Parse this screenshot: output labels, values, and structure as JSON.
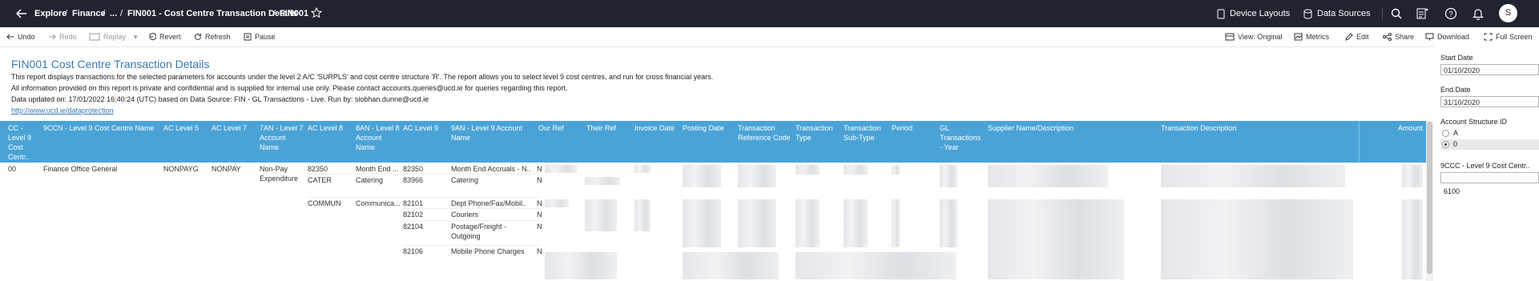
{
  "topbar": {
    "breadcrumb": [
      "Explore",
      "Finance",
      "...",
      "FIN001 - Cost Centre Transaction Details",
      "FIN001"
    ],
    "device_layouts": "Device Layouts",
    "data_sources": "Data Sources",
    "avatar_letter": "S"
  },
  "toolbar": {
    "undo": "Undo",
    "redo": "Redo",
    "replay": "Replay",
    "revert": "Revert",
    "refresh": "Refresh",
    "pause": "Pause",
    "view": "View: Original",
    "metrics": "Metrics",
    "edit": "Edit",
    "share": "Share",
    "download": "Download",
    "fullscreen": "Full Screen"
  },
  "report": {
    "title": "FIN001 Cost Centre Transaction Details",
    "desc1": "This report displays transactions for the selected parameters for accounts under the level 2 A/C 'SURPLS' and cost centre structure 'R'.  The report allows you to select level 9 cost centres, and run for cross financial years.",
    "desc2": "All information provided on this report is private and confidential and is supplied for internal use only. Please contact accounts.queries@ucd.ie for queries regarding this report.",
    "desc3": "Data updated on: 17/01/2022 16:40:24 (UTC) based on Data Source: FIN - GL Transactions  -  Live. Run by: siobhan.dunne@ucd.ie",
    "link": "http://www.ucd.ie/dataprotection"
  },
  "table": {
    "headers": [
      "CC - Level 9 Cost Centr..",
      "9CCN - Level 9 Cost Centre Name",
      "AC Level 5",
      "AC Level 7",
      "7AN - Level 7 Account Name",
      "AC Level 8",
      "8AN - Level 8 Account Name",
      "AC Level 9",
      "9AN - Level 9 Account Name",
      "Our Ref",
      "Their Ref",
      "Invoice Date",
      "Posting Date",
      "Transaction Reference Code",
      "Transaction Type",
      "Transaction Sub-Type",
      "Period",
      "GL Transactions - Year",
      "Supplier Name/Description",
      "Transaction Description",
      "Amount"
    ],
    "cc_value": "00",
    "cc_name": "Finance Office General",
    "ac5": "NONPAYG",
    "ac7": "NONPAY",
    "ac7_name": "Non-Pay Expenditure",
    "rows": [
      {
        "ac8": "82350",
        "ac8_name": "Month End ...",
        "ac9": "82350",
        "ac9_name": "Month End Accruals - N..",
        "ref": "N"
      },
      {
        "ac8": "CATER",
        "ac8_name": "Catering",
        "ac9": "83966",
        "ac9_name": "Catering",
        "ref": "N"
      },
      {
        "ac8": "COMMUN",
        "ac8_name": "Communica...",
        "ac9": "82101",
        "ac9_name": "Dept Phone/Fax/Mobil..",
        "ref": "N"
      },
      {
        "ac8": "",
        "ac8_name": "",
        "ac9": "82102",
        "ac9_name": "Couriers",
        "ref": "N"
      },
      {
        "ac8": "",
        "ac8_name": "",
        "ac9": "82104",
        "ac9_name": "Postage/Freight - Outgoing",
        "ref": "N"
      },
      {
        "ac8": "",
        "ac8_name": "",
        "ac9": "82106",
        "ac9_name": "Mobile Phone Charges",
        "ref": "N"
      }
    ]
  },
  "params": {
    "start_label": "Start Date",
    "start_value": "01/10/2020",
    "end_label": "End Date",
    "end_value": "31/10/2020",
    "structure_label": "Account Structure ID",
    "structure_options": [
      "A",
      "0"
    ],
    "structure_selected": "0",
    "cc_label": "9CCC - Level 9 Cost Centr..",
    "cc_input": "",
    "cc_value": "6100"
  }
}
